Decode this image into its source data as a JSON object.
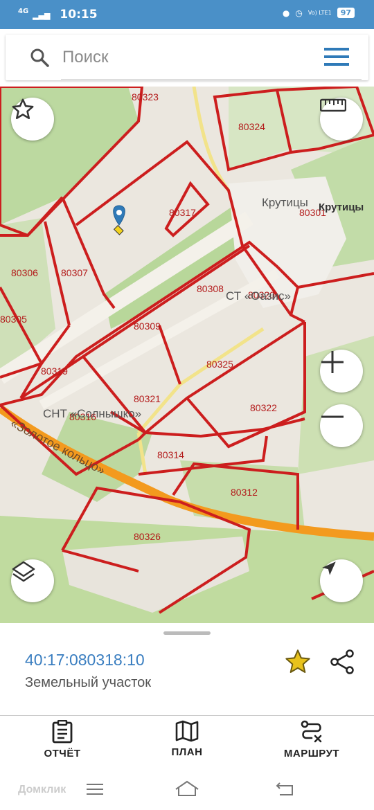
{
  "status_bar": {
    "network": "4G",
    "time": "10:15",
    "volte": "Vo) LTE1",
    "battery": "97"
  },
  "search": {
    "placeholder": "Поиск"
  },
  "map": {
    "parcels": [
      "80323",
      "80324",
      "80317",
      "80301",
      "80306",
      "80307",
      "80308",
      "80320",
      "80305",
      "80309",
      "80319",
      "80325",
      "80321",
      "80322",
      "80316",
      "80314",
      "80312",
      "80326"
    ],
    "places": [
      "Крутицы",
      "Крутицы",
      "СТ «Оазис»",
      "СНТ «Солнышко»",
      "«Золотое кольцо»"
    ]
  },
  "selected": {
    "cadastral_number": "40:17:080318:10",
    "type": "Земельный участок"
  },
  "actions": {
    "report": "ОТЧЁТ",
    "plan": "ПЛАН",
    "route": "МАРШРУТ"
  },
  "watermark": "Домклик",
  "colors": {
    "status_bar": "#4a90c8",
    "parcel_border": "#cc1e1e",
    "accent": "#3a7ec0",
    "favorite": "#e8c21c"
  }
}
